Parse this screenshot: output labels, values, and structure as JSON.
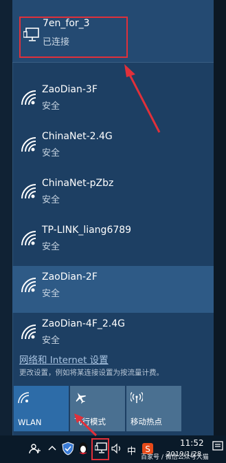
{
  "connected": {
    "name": "7en_for_3",
    "status": "已连接"
  },
  "networks": [
    {
      "name": "ZaoDian-3F",
      "status": "安全"
    },
    {
      "name": "ChinaNet-2.4G",
      "status": "安全"
    },
    {
      "name": "ChinaNet-pZbz",
      "status": "安全"
    },
    {
      "name": "TP-LINK_liang6789",
      "status": "安全"
    },
    {
      "name": "ZaoDian-2F",
      "status": "安全"
    },
    {
      "name": "ZaoDian-4F_2.4G",
      "status": "安全"
    }
  ],
  "settings": {
    "link": "网络和 Internet 设置",
    "description": "更改设置，例如将某连接设置为按流量计费。"
  },
  "tiles": {
    "wlan": "WLAN",
    "airplane": "飞行模式",
    "hotspot": "移动热点"
  },
  "taskbar": {
    "ime": "中",
    "time": "11:52",
    "date": "2019/1/28",
    "watermark": "百家号 / 微信公众号大猫"
  },
  "colors": {
    "accent_red": "#e0303a",
    "panel_bg": "#1d3f63"
  }
}
